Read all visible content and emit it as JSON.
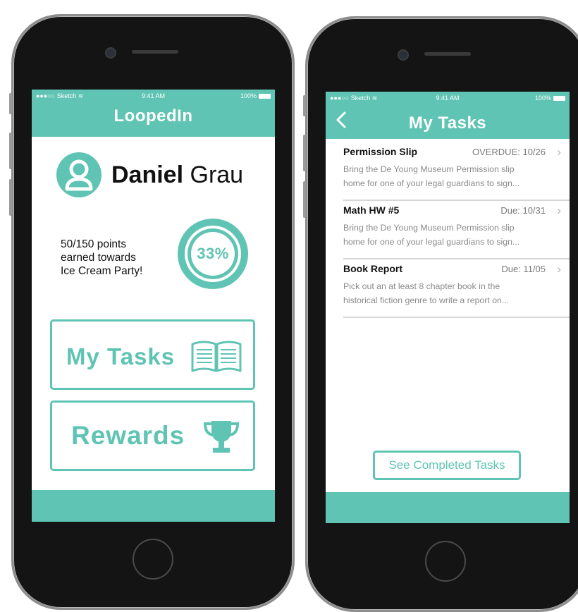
{
  "statusbar": {
    "carrier": "Sketch",
    "time": "9:41 AM",
    "battery": "100%"
  },
  "home": {
    "title": "LoopedIn",
    "user": {
      "first_name": "Daniel",
      "last_name": "Grau"
    },
    "points": {
      "line1": "50/150 points",
      "line2": "earned towards",
      "line3": "Ice Cream Party!",
      "percent_label": "33%",
      "progress": 0.33
    },
    "buttons": {
      "tasks_label": "My Tasks",
      "rewards_label": "Rewards"
    }
  },
  "tasks_screen": {
    "title": "My Tasks",
    "items": [
      {
        "title": "Permission Slip",
        "due": "OVERDUE: 10/26",
        "desc_line1": "Bring the De Young Museum Permission slip",
        "desc_line2": "home for one of your legal guardians to sign..."
      },
      {
        "title": "Math HW #5",
        "due": "Due: 10/31",
        "desc_line1": "Bring the De Young Museum Permission slip",
        "desc_line2": "home for one of your legal guardians to sign..."
      },
      {
        "title": "Book Report",
        "due": "Due: 11/05",
        "desc_line1": "Pick out an at least 8 chapter book in the",
        "desc_line2": "historical fiction genre to write a report on..."
      }
    ],
    "see_completed_label": "See Completed Tasks"
  },
  "icons": {
    "avatar": "user-avatar-icon",
    "book": "open-book-icon",
    "trophy": "trophy-icon",
    "back": "chevron-left-icon",
    "row_chevron": "chevron-right-icon",
    "wifi": "wifi-icon",
    "battery": "battery-icon"
  },
  "colors": {
    "accent": "#5fc4b3",
    "bezel": "#141414",
    "ring_track": "#ffffff"
  }
}
